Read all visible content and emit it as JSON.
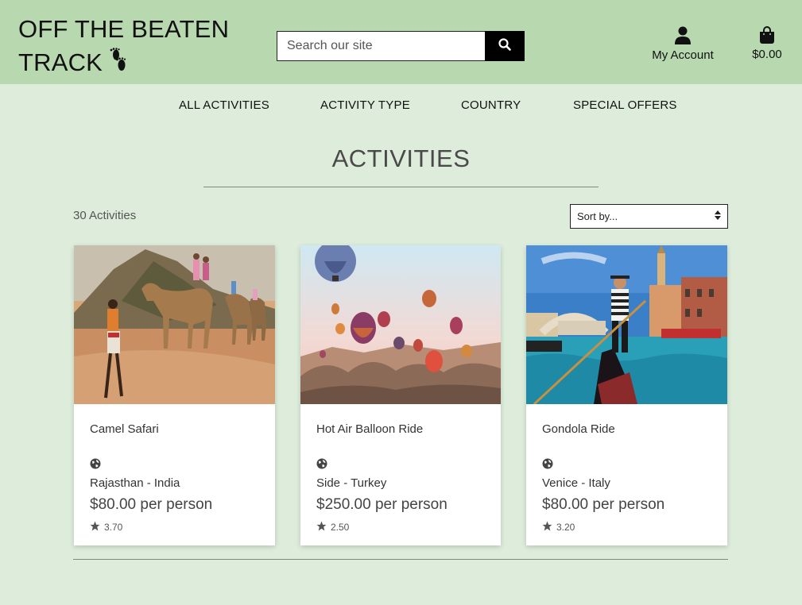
{
  "header": {
    "logo_line1": "OFF THE BEATEN",
    "logo_line2": "TRACK",
    "search_placeholder": "Search our site",
    "account_label": "My Account",
    "bag_total": "$0.00"
  },
  "nav": {
    "items": [
      {
        "label": "ALL ACTIVITIES"
      },
      {
        "label": "ACTIVITY TYPE"
      },
      {
        "label": "COUNTRY"
      },
      {
        "label": "SPECIAL OFFERS"
      }
    ]
  },
  "main": {
    "title": "ACTIVITIES",
    "count": "30 Activities",
    "sort_label": "Sort by..."
  },
  "cards": [
    {
      "name": "Camel Safari",
      "location": "Rajasthan - India",
      "price": "$80.00 per person",
      "rating": "3.70"
    },
    {
      "name": "Hot Air Balloon Ride",
      "location": "Side - Turkey",
      "price": "$250.00 per person",
      "rating": "2.50"
    },
    {
      "name": "Gondola Ride",
      "location": "Venice - Italy",
      "price": "$80.00 per person",
      "rating": "3.20"
    }
  ],
  "colors": {
    "header_bg": "#b8d8b0",
    "page_bg": "#deeddb",
    "search_button": "#000000"
  },
  "icons": [
    "footprints-icon",
    "search-icon",
    "user-icon",
    "shopping-bag-icon",
    "globe-icon",
    "star-icon",
    "sort-arrows-icon"
  ]
}
